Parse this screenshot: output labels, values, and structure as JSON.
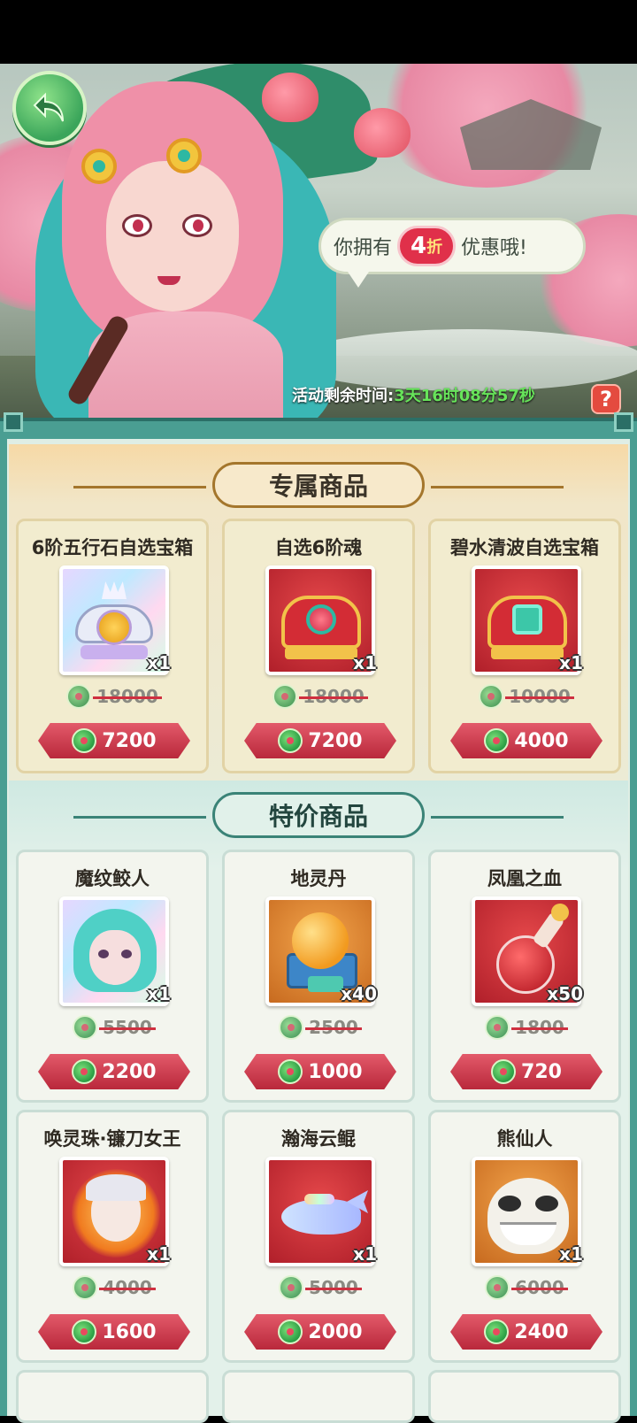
{
  "banner": {
    "speech_prefix": "你拥有",
    "discount_num": "4",
    "discount_unit": "折",
    "speech_suffix": "优惠哦!",
    "timer_label": "活动剩余时间:",
    "timer_value": "3天16时08分57秒",
    "help_label": "?"
  },
  "sections": {
    "exclusive_title": "专属商品",
    "special_title": "特价商品"
  },
  "exclusive_items": [
    {
      "name": "6阶五行石自选宝箱",
      "qty": "x1",
      "old_price": "18000",
      "price": "7200",
      "icon": "silver-chest-icon"
    },
    {
      "name": "自选6阶魂",
      "qty": "x1",
      "old_price": "18000",
      "price": "7200",
      "icon": "red-chest-icon"
    },
    {
      "name": "碧水清波自选宝箱",
      "qty": "x1",
      "old_price": "10000",
      "price": "4000",
      "icon": "red-chest-icon"
    }
  ],
  "special_items": [
    {
      "name": "魔纹鲛人",
      "qty": "x1",
      "old_price": "5500",
      "price": "2200",
      "icon": "mermaid-portrait-icon"
    },
    {
      "name": "地灵丹",
      "qty": "x40",
      "old_price": "2500",
      "price": "1000",
      "icon": "golden-orb-icon"
    },
    {
      "name": "凤凰之血",
      "qty": "x50",
      "old_price": "1800",
      "price": "720",
      "icon": "potion-bottle-icon"
    },
    {
      "name": "唤灵珠·镰刀女王",
      "qty": "x1",
      "old_price": "4000",
      "price": "1600",
      "icon": "scythe-queen-icon"
    },
    {
      "name": "瀚海云鲲",
      "qty": "x1",
      "old_price": "5000",
      "price": "2000",
      "icon": "whale-mount-icon"
    },
    {
      "name": "熊仙人",
      "qty": "x1",
      "old_price": "6000",
      "price": "2400",
      "icon": "panda-sage-icon"
    }
  ]
}
